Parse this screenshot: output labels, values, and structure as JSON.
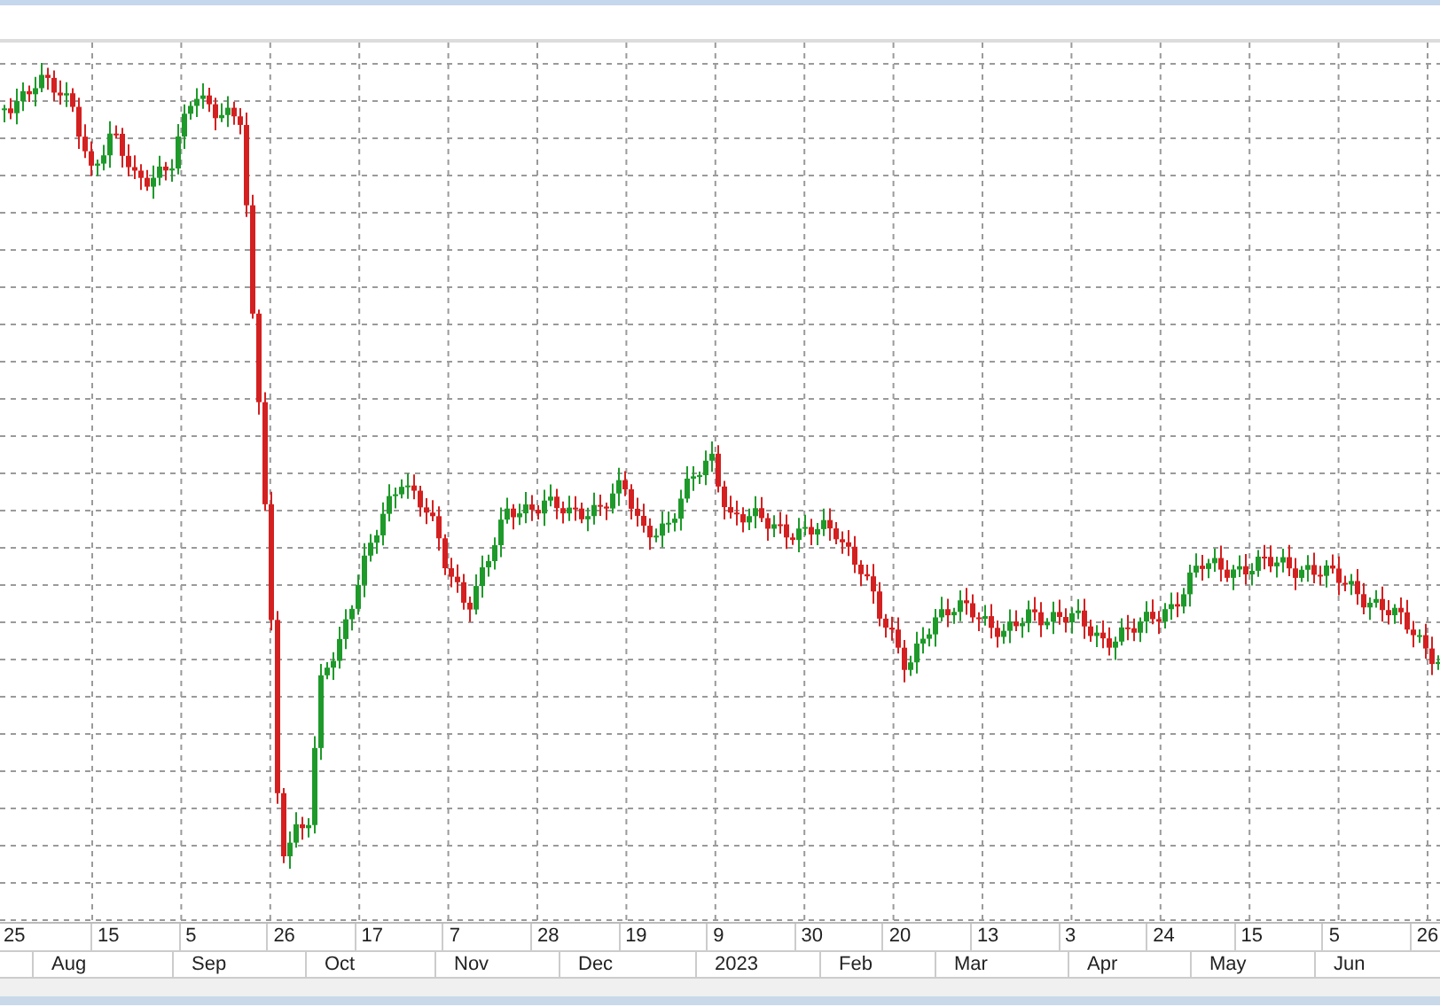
{
  "chart": {
    "day_labels": [
      "25",
      "15",
      "5",
      "26",
      "17",
      "7",
      "28",
      "19",
      "9",
      "30",
      "20",
      "13",
      "3",
      "24",
      "15",
      "5",
      "26"
    ],
    "month_labels": [
      "Aug",
      "Sep",
      "Oct",
      "Nov",
      "Dec",
      "2023",
      "Feb",
      "Mar",
      "Apr",
      "May",
      "Jun"
    ]
  }
}
